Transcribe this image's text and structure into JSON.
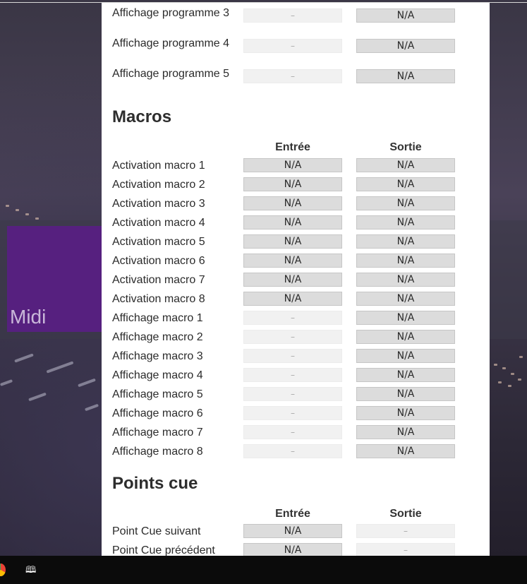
{
  "background": {
    "tile_label": "Midi",
    "tile_color": "#56207f"
  },
  "program_rows": [
    {
      "label": "Affichage programme 3",
      "input": "–",
      "output": "N/A"
    },
    {
      "label": "Affichage programme 4",
      "input": "–",
      "output": "N/A"
    },
    {
      "label": "Affichage programme 5",
      "input": "–",
      "output": "N/A"
    }
  ],
  "macros": {
    "title": "Macros",
    "header_in": "Entrée",
    "header_out": "Sortie",
    "rows": [
      {
        "label": "Activation macro 1",
        "input": "N/A",
        "output": "N/A"
      },
      {
        "label": "Activation macro 2",
        "input": "N/A",
        "output": "N/A"
      },
      {
        "label": "Activation macro 3",
        "input": "N/A",
        "output": "N/A"
      },
      {
        "label": "Activation macro 4",
        "input": "N/A",
        "output": "N/A"
      },
      {
        "label": "Activation macro 5",
        "input": "N/A",
        "output": "N/A"
      },
      {
        "label": "Activation macro 6",
        "input": "N/A",
        "output": "N/A"
      },
      {
        "label": "Activation macro 7",
        "input": "N/A",
        "output": "N/A"
      },
      {
        "label": "Activation macro 8",
        "input": "N/A",
        "output": "N/A"
      },
      {
        "label": "Affichage macro 1",
        "input": "–",
        "output": "N/A"
      },
      {
        "label": "Affichage macro 2",
        "input": "–",
        "output": "N/A"
      },
      {
        "label": "Affichage macro 3",
        "input": "–",
        "output": "N/A"
      },
      {
        "label": "Affichage macro 4",
        "input": "–",
        "output": "N/A"
      },
      {
        "label": "Affichage macro 5",
        "input": "–",
        "output": "N/A"
      },
      {
        "label": "Affichage macro 6",
        "input": "–",
        "output": "N/A"
      },
      {
        "label": "Affichage macro 7",
        "input": "–",
        "output": "N/A"
      },
      {
        "label": "Affichage macro 8",
        "input": "–",
        "output": "N/A"
      }
    ]
  },
  "cues": {
    "title": "Points cue",
    "header_in": "Entrée",
    "header_out": "Sortie",
    "rows": [
      {
        "label": "Point Cue suivant",
        "input": "N/A",
        "output": "–"
      },
      {
        "label": "Point Cue précédent",
        "input": "N/A",
        "output": "–"
      }
    ]
  },
  "taskbar": {
    "icons": [
      "chrome-icon",
      "book-icon"
    ]
  }
}
